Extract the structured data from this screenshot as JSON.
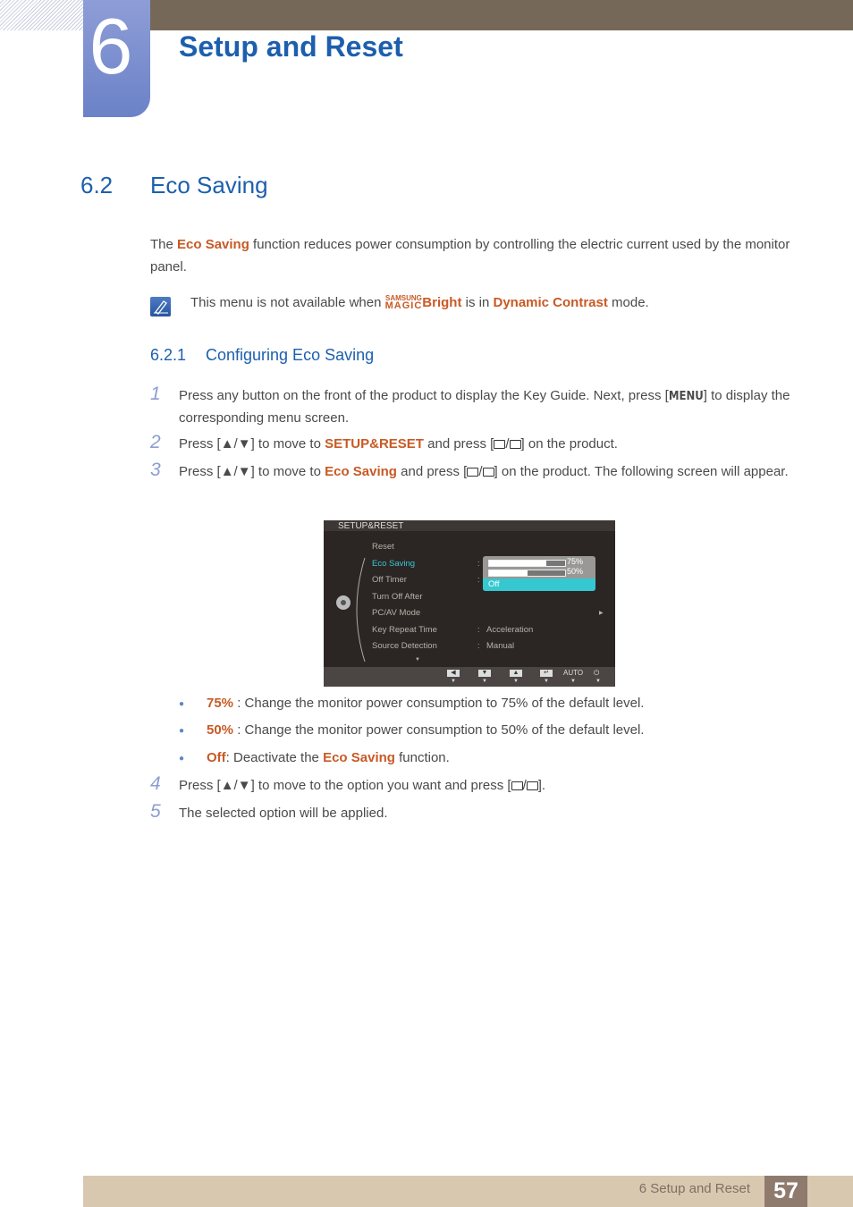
{
  "chapter": {
    "number": "6",
    "title": "Setup and Reset"
  },
  "section": {
    "number": "6.2",
    "title": "Eco Saving"
  },
  "intro": {
    "pre": "The ",
    "highlight": "Eco Saving",
    "post": " function reduces power consumption by controlling the electric current used by the monitor panel."
  },
  "note": {
    "pre": "This menu is not available when ",
    "brand_top": "SAMSUNG",
    "brand_bottom": "MAGIC",
    "brand_word": "Bright",
    "mid": " is in ",
    "highlight": "Dynamic Contrast",
    "post": " mode."
  },
  "subsection": {
    "number": "6.2.1",
    "title": "Configuring Eco Saving"
  },
  "steps": [
    {
      "num": "1",
      "pre": "Press any button on the front of the product to display the Key Guide. Next, press [",
      "key": "MENU",
      "post": "] to display the corresponding menu screen."
    },
    {
      "num": "2",
      "pre": "Press [",
      "arrows": "▲/▼",
      "mid": "] to move to ",
      "highlight": "SETUP&RESET",
      "mid2": " and press [",
      "post": "] on the product."
    },
    {
      "num": "3",
      "pre": "Press [",
      "arrows": "▲/▼",
      "mid": "] to move to ",
      "highlight": "Eco Saving",
      "mid2": " and press [",
      "post": "] on the product. The following screen will appear."
    },
    {
      "num": "4",
      "pre": "Press [",
      "arrows": "▲/▼",
      "mid": "] to move to the option you want and press [",
      "post": "]."
    },
    {
      "num": "5",
      "text": "The selected option will be applied."
    }
  ],
  "osd": {
    "title": "SETUP&RESET",
    "items": [
      "Reset",
      "Eco Saving",
      "Off Timer",
      "Turn Off After",
      "PC/AV Mode",
      "Key Repeat Time",
      "Source Detection"
    ],
    "values": {
      "key_repeat": "Acceleration",
      "source_detection": "Manual"
    },
    "popup": {
      "options": [
        {
          "label": "75%",
          "level": 0.75
        },
        {
          "label": "50%",
          "level": 0.5
        }
      ],
      "selected": "Off"
    },
    "buttons": [
      "◀",
      "▼",
      "▲",
      "↵",
      "AUTO",
      "⏻"
    ]
  },
  "bullets": [
    {
      "highlight": "75%",
      "text": " : Change the monitor power consumption to 75% of the default level."
    },
    {
      "highlight": "50%",
      "text": " : Change the monitor power consumption to 50% of the default level."
    },
    {
      "highlight": "Off",
      "text": ": Deactivate the ",
      "highlight2": "Eco Saving",
      "text2": " function."
    }
  ],
  "footer": {
    "label": "6 Setup and Reset",
    "page": "57"
  }
}
